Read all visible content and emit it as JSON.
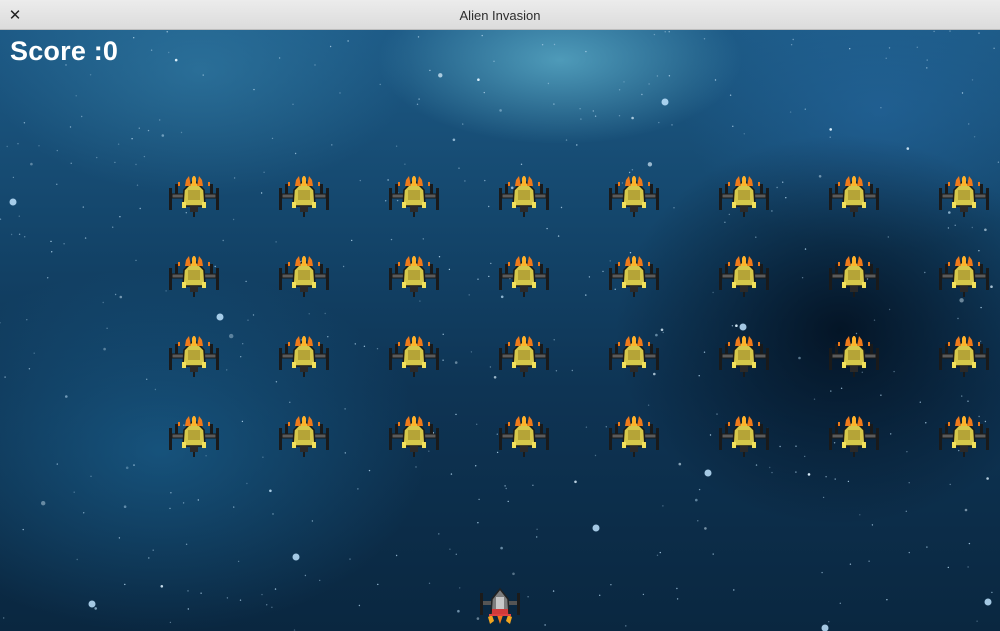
{
  "window": {
    "title": "Alien Invasion",
    "close_icon": "close-icon"
  },
  "hud": {
    "score_text": "Score :0"
  },
  "fleet": {
    "rows": 4,
    "columns": 8,
    "sprite": "alien-ship-icon"
  },
  "player": {
    "sprite": "player-ship-icon"
  },
  "colors": {
    "titlebar": "#e4e4e4",
    "space_dark": "#0a2740",
    "space_light": "#1d5a86",
    "score_text": "#ffffff",
    "alien_body": "#d6c84a",
    "alien_flame": "#f07a1a"
  }
}
